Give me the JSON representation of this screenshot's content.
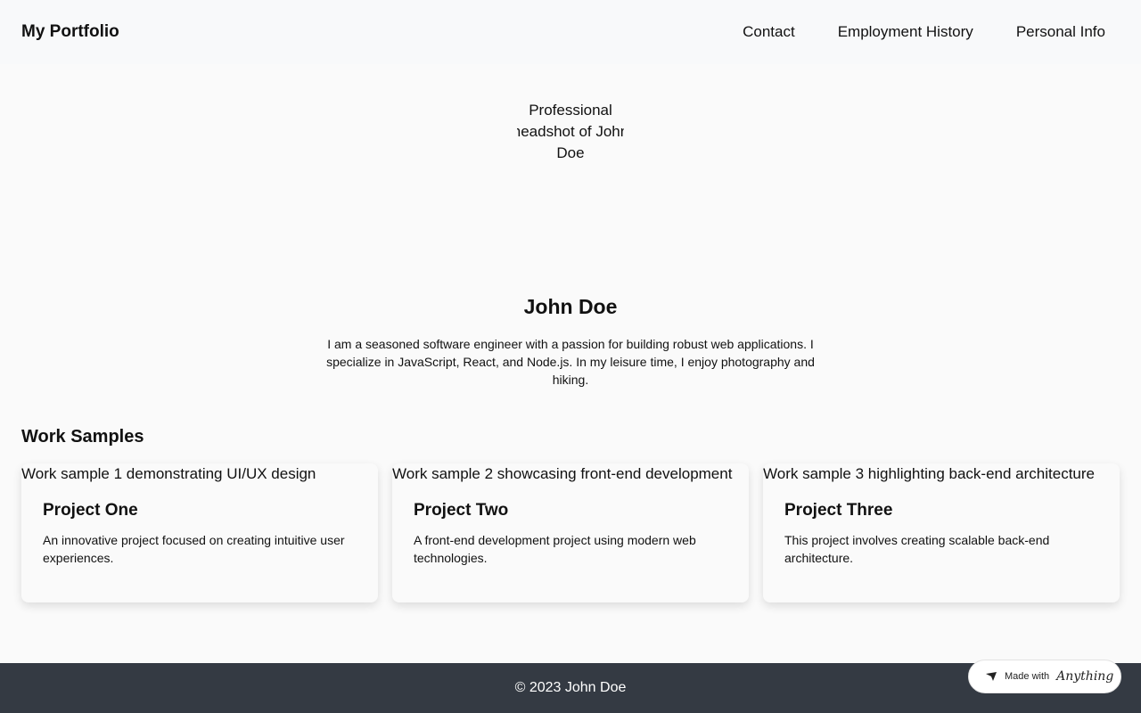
{
  "header": {
    "brand": "My Portfolio",
    "nav": [
      "Contact",
      "Employment History",
      "Personal Info"
    ]
  },
  "profile": {
    "avatar_alt": "Professional headshot of John Doe",
    "name": "John Doe",
    "bio": "I am a seasoned software engineer with a passion for building robust web applications. I specialize in JavaScript, React, and Node.js. In my leisure time, I enjoy photography and hiking."
  },
  "work": {
    "title": "Work Samples",
    "projects": [
      {
        "img_alt": "Work sample 1 demonstrating UI/UX design",
        "title": "Project One",
        "desc": "An innovative project focused on creating intuitive user experiences."
      },
      {
        "img_alt": "Work sample 2 showcasing front-end development",
        "title": "Project Two",
        "desc": "A front-end development project using modern web technologies."
      },
      {
        "img_alt": "Work sample 3 highlighting back-end architecture",
        "title": "Project Three",
        "desc": "This project involves creating scalable back-end architecture."
      }
    ]
  },
  "footer": {
    "text": "© 2023 John Doe"
  },
  "badge": {
    "prefix": "Made with",
    "brand": "Anything"
  },
  "colors": {
    "footer_bg": "#343a43",
    "page_bg": "#fafafa",
    "header_bg": "#f8f9fa"
  }
}
